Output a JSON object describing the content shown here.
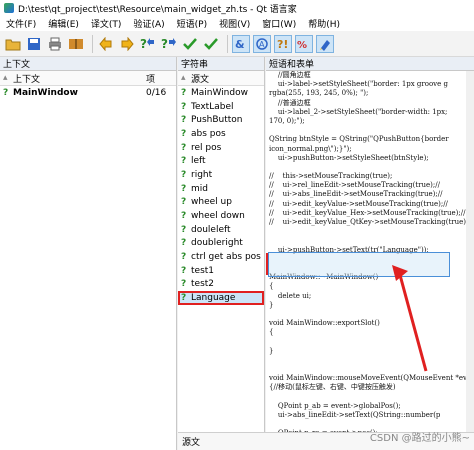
{
  "window": {
    "title": "D:\\test\\qt_project\\test\\Resource\\main_widget_zh.ts - Qt 语言家"
  },
  "menu": [
    "文件(F)",
    "编辑(E)",
    "译文(T)",
    "验证(A)",
    "短语(P)",
    "视图(V)",
    "窗口(W)",
    "帮助(H)"
  ],
  "toolbar": {
    "icons": [
      "open-icon",
      "save-icon",
      "print-icon",
      "book-icon",
      "arrow-left-icon",
      "arrow-right-icon",
      "question-arrow-icon",
      "question-arrow-next-icon",
      "check-icon",
      "check-next-icon",
      "accelerator-icon",
      "phrase-icon",
      "punctuation-icon",
      "phrase-match-icon"
    ]
  },
  "context_pane": {
    "title": "上下文",
    "col_context": "上下文",
    "col_count": "项",
    "rows": [
      {
        "name": "MainWindow",
        "count": "0/16"
      }
    ]
  },
  "strings_pane": {
    "title": "字符串",
    "col_source": "源文",
    "items": [
      "MainWindow",
      "TextLabel",
      "PushButton",
      "abs pos",
      "rel pos",
      "left",
      "right",
      "mid",
      "wheel up",
      "wheel down",
      "douleleft",
      "doubleright",
      "ctrl get abs pos",
      "test1",
      "test2",
      "Language"
    ]
  },
  "code_pane": {
    "title": "短语和表单",
    "lines": [
      "    //圆角边框",
      "    ui->label->setStyleSheet(\"border: 1px groove g",
      "rgba(255, 193, 245, 0%); \");",
      "    //普通边框",
      "    ui->label_2->setStyleSheet(\"border-width: 1px;",
      "170, 0);\");",
      "",
      "QString btnStyle = QString(\"QPushButton{border",
      "icon_normal.png\\\");}\");",
      "    ui->pushButton->setStyleSheet(btnStyle);",
      "",
      "//    this->setMouseTracking(true);",
      "//    ui->rel_lineEdit->setMouseTracking(true);//",
      "//    ui->abs_lineEdit->setMouseTracking(true);//",
      "//    ui->edit_keyValue->setMouseTracking(true);//",
      "//    ui->edit_keyValue_Hex->setMouseTracking(true);//",
      "//    ui->edit_keyValue_QtKey->setMouseTracking(true)",
      "",
      "",
      "    ui->pushButton->setText(tr(\"Language\"));",
      "",
      "",
      "MainWindow::~MainWindow()",
      "{",
      "    delete ui;",
      "}",
      "",
      "void MainWindow::exportSlot()",
      "{",
      "",
      "}",
      "",
      "",
      "void MainWindow::mouseMoveEvent(QMouseEvent *event",
      "{//移动(鼠标左键、右键、中键按压触发)",
      "",
      "    QPoint p_ab = event->globalPos();",
      "    ui->abs_lineEdit->setText(QString::number(p",
      "",
      "    QPoint p_re = event->pos();"
    ]
  },
  "source_label": "源文",
  "watermark": "CSDN @路过的小熊~"
}
